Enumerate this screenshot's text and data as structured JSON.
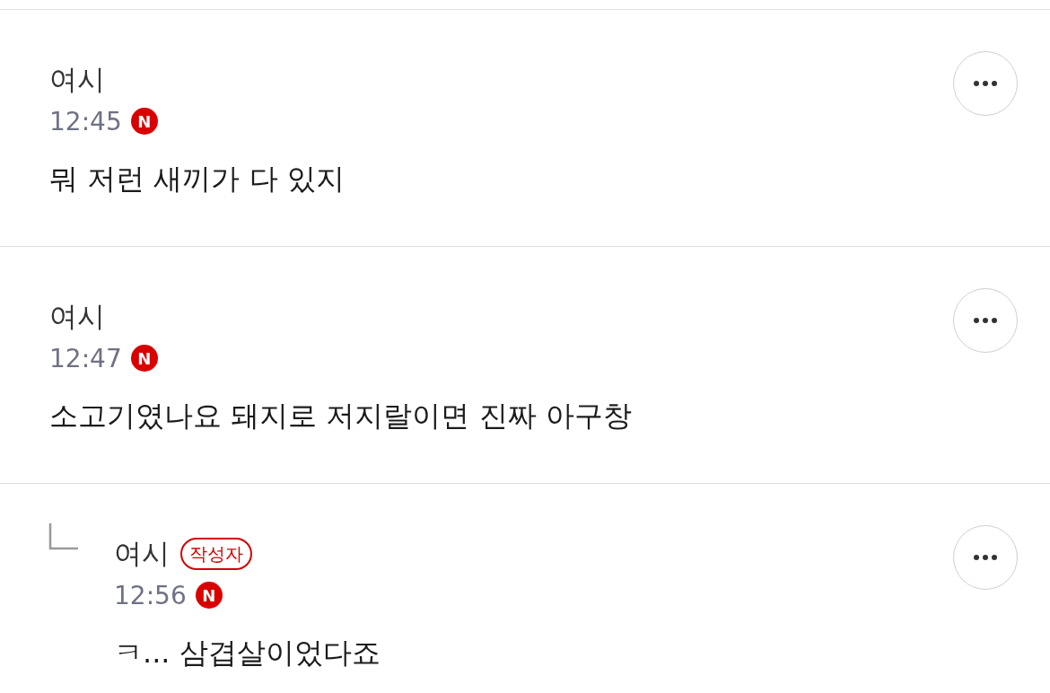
{
  "comments": [
    {
      "kind": "comment",
      "author": "여시",
      "time": "12:45",
      "new_badge": "N",
      "text": "뭐 저런 새끼가 다 있지"
    },
    {
      "kind": "comment",
      "author": "여시",
      "time": "12:47",
      "new_badge": "N",
      "text": "소고기였나요 돼지로 저지랄이면 진짜 아구창"
    },
    {
      "kind": "reply",
      "author": "여시",
      "author_badge": "작성자",
      "time": "12:56",
      "new_badge": "N",
      "text": "ㅋ... 삼겹살이었다죠"
    }
  ]
}
